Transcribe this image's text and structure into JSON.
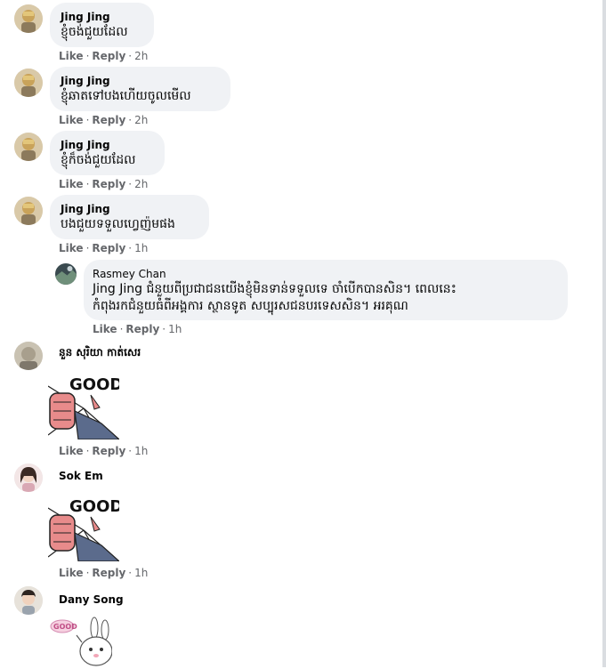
{
  "actions": {
    "like": "Like",
    "reply": "Reply",
    "separator": "·"
  },
  "comments": [
    {
      "author": "Jing Jing",
      "text": "ខ្ញុំចង់ជួយដែល",
      "time": "2h"
    },
    {
      "author": "Jing Jing",
      "text": "ខ្ញុំឆាតទៅបងហើយចូលមើល",
      "time": "2h"
    },
    {
      "author": "Jing Jing",
      "text": "ខ្ញុំក៏ចង់ជួយដែល",
      "time": "2h"
    },
    {
      "author": "Jing Jing",
      "text": "បងជួយទទួលហ្វេញ៉មផង",
      "time": "1h"
    }
  ],
  "reply": {
    "author": "Rasmey Chan",
    "mention": "Jing Jing",
    "line1": "ជំនួយពីប្រជាជនយើងខ្ញុំមិនទាន់ទទួលទេ ចាំបើកបានសិន។ ពេលនេះ",
    "line2": "កំពុងរកជំនួយធំពីអង្គការ ស្ថានទូត សប្បុរសជនបរទេសសិន។ អរគុណ",
    "time": "1h"
  },
  "sticker_comments": [
    {
      "author": "នួន សុរិយា កាត់សេរ",
      "sticker_text": "GOOD",
      "time": "1h"
    },
    {
      "author": "Sok Em",
      "sticker_text": "GOOD",
      "time": "1h"
    }
  ],
  "last_comment": {
    "author": "Dany Song",
    "sticker_text": "GOOD"
  }
}
